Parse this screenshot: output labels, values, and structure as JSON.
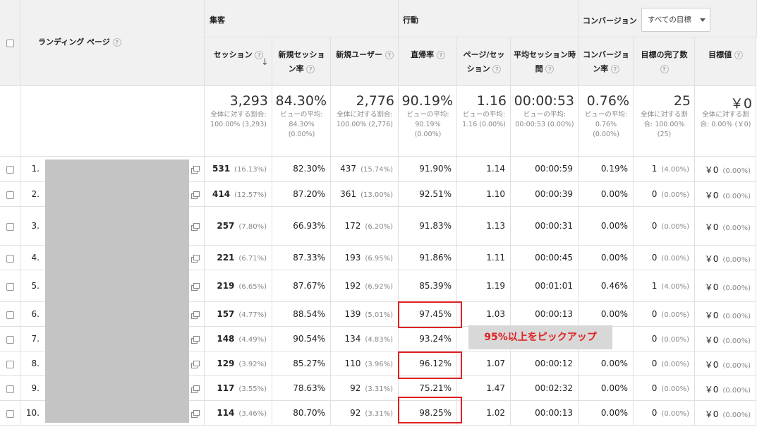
{
  "header": {
    "landing_page": "ランディング ページ",
    "group_acquisition": "集客",
    "group_behavior": "行動",
    "group_conversion": "コンバージョン",
    "goal_select": "すべての目標",
    "cols": [
      "セッション",
      "新規セッション率",
      "新規ユーザー",
      "直帰率",
      "ページ/セッション",
      "平均セッション時間",
      "コンバージョン率",
      "目標の完了数",
      "目標値"
    ]
  },
  "totals": [
    {
      "big": "3,293",
      "sub": "全体に対する割合: 100.00% (3,293)"
    },
    {
      "big": "84.30%",
      "sub": "ビューの平均: 84.30% (0.00%)"
    },
    {
      "big": "2,776",
      "sub": "全体に対する割合: 100.00% (2,776)"
    },
    {
      "big": "90.19%",
      "sub": "ビューの平均: 90.19% (0.00%)"
    },
    {
      "big": "1.16",
      "sub": "ビューの平均: 1.16 (0.00%)"
    },
    {
      "big": "00:00:53",
      "sub": "ビューの平均: 00:00:53 (0.00%)"
    },
    {
      "big": "0.76%",
      "sub": "ビューの平均: 0.76% (0.00%)"
    },
    {
      "big": "25",
      "sub": "全体に対する割合: 100.00% (25)"
    },
    {
      "big": "￥0",
      "sub": "全体に対する割合: 0.00% (￥0)"
    }
  ],
  "rows": [
    {
      "n": "1.",
      "s": "531",
      "sp": "(16.13%)",
      "nr": "82.30%",
      "nu": "437",
      "nup": "(15.74%)",
      "b": "91.90%",
      "pps": "1.14",
      "t": "00:00:59",
      "cr": "0.19%",
      "gc": "1",
      "gcp": "(4.00%)",
      "gv": "￥0",
      "gvp": "(0.00%)"
    },
    {
      "n": "2.",
      "s": "414",
      "sp": "(12.57%)",
      "nr": "87.20%",
      "nu": "361",
      "nup": "(13.00%)",
      "b": "92.51%",
      "pps": "1.10",
      "t": "00:00:39",
      "cr": "0.00%",
      "gc": "0",
      "gcp": "(0.00%)",
      "gv": "￥0",
      "gvp": "(0.00%)"
    },
    {
      "n": "3.",
      "s": "257",
      "sp": "(7.80%)",
      "nr": "66.93%",
      "nu": "172",
      "nup": "(6.20%)",
      "b": "91.83%",
      "pps": "1.13",
      "t": "00:00:31",
      "cr": "0.00%",
      "gc": "0",
      "gcp": "(0.00%)",
      "gv": "￥0",
      "gvp": "(0.00%)"
    },
    {
      "n": "4.",
      "s": "221",
      "sp": "(6.71%)",
      "nr": "87.33%",
      "nu": "193",
      "nup": "(6.95%)",
      "b": "91.86%",
      "pps": "1.11",
      "t": "00:00:45",
      "cr": "0.00%",
      "gc": "0",
      "gcp": "(0.00%)",
      "gv": "￥0",
      "gvp": "(0.00%)"
    },
    {
      "n": "5.",
      "s": "219",
      "sp": "(6.65%)",
      "nr": "87.67%",
      "nu": "192",
      "nup": "(6.92%)",
      "b": "85.39%",
      "pps": "1.19",
      "t": "00:01:01",
      "cr": "0.46%",
      "gc": "1",
      "gcp": "(4.00%)",
      "gv": "￥0",
      "gvp": "(0.00%)"
    },
    {
      "n": "6.",
      "s": "157",
      "sp": "(4.77%)",
      "nr": "88.54%",
      "nu": "139",
      "nup": "(5.01%)",
      "b": "97.45%",
      "pps": "1.03",
      "t": "00:00:13",
      "cr": "0.00%",
      "gc": "0",
      "gcp": "(0.00%)",
      "gv": "￥0",
      "gvp": "(0.00%)"
    },
    {
      "n": "7.",
      "s": "148",
      "sp": "(4.49%)",
      "nr": "90.54%",
      "nu": "134",
      "nup": "(4.83%)",
      "b": "93.24%",
      "pps": "",
      "t": "",
      "cr": "",
      "gc": "0",
      "gcp": "(0.00%)",
      "gv": "￥0",
      "gvp": "(0.00%)"
    },
    {
      "n": "8.",
      "s": "129",
      "sp": "(3.92%)",
      "nr": "85.27%",
      "nu": "110",
      "nup": "(3.96%)",
      "b": "96.12%",
      "pps": "1.07",
      "t": "00:00:12",
      "cr": "0.00%",
      "gc": "0",
      "gcp": "(0.00%)",
      "gv": "￥0",
      "gvp": "(0.00%)"
    },
    {
      "n": "9.",
      "s": "117",
      "sp": "(3.55%)",
      "nr": "78.63%",
      "nu": "92",
      "nup": "(3.31%)",
      "b": "75.21%",
      "pps": "1.47",
      "t": "00:02:32",
      "cr": "0.00%",
      "gc": "0",
      "gcp": "(0.00%)",
      "gv": "￥0",
      "gvp": "(0.00%)"
    },
    {
      "n": "10.",
      "s": "114",
      "sp": "(3.46%)",
      "nr": "80.70%",
      "nu": "92",
      "nup": "(3.31%)",
      "b": "98.25%",
      "pps": "1.02",
      "t": "00:00:13",
      "cr": "0.00%",
      "gc": "0",
      "gcp": "(0.00%)",
      "gv": "￥0",
      "gvp": "(0.00%)"
    }
  ],
  "annotation": "95%以上をピックアップ",
  "colors": {
    "highlight": "#e02020",
    "header_bg": "#f1f1f1",
    "redacted": "#c4c4c4"
  }
}
